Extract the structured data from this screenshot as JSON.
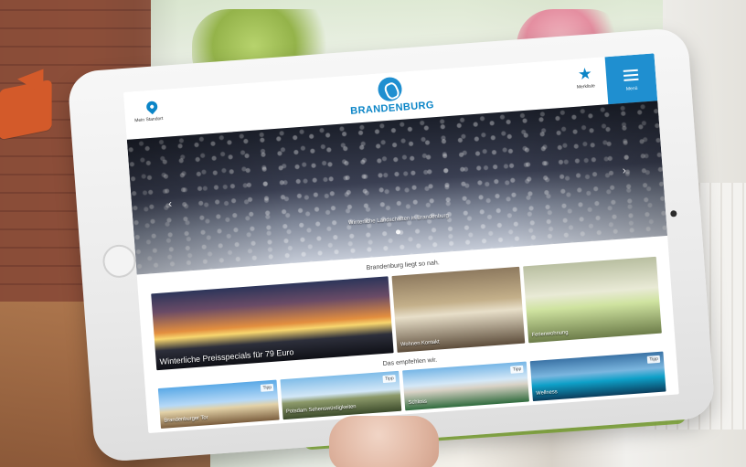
{
  "site": {
    "logo_text": "BRANDENBURG",
    "location_label": "Mein Standort",
    "merkliste_label": "Merkliste",
    "menu_label": "Menü"
  },
  "hero": {
    "caption": "Winterliche Landschaften in Brandenburg",
    "arrow_left": "‹",
    "arrow_right": "›"
  },
  "sections": [
    {
      "title": "Brandenburg liegt so nah.",
      "cards": [
        {
          "caption": "Winterliche Preisspecials für 79 Euro"
        },
        {
          "caption": "Wohnen Kontakt"
        },
        {
          "caption": "Ferienwohnung"
        }
      ]
    },
    {
      "title": "Das empfehlen wir.",
      "cards": [
        {
          "caption": "Brandenburger Tor",
          "tag": "Tipp"
        },
        {
          "caption": "Potsdam Sehenswürdigkeiten",
          "tag": "Tipp"
        },
        {
          "caption": "Schloss",
          "tag": "Tipp"
        },
        {
          "caption": "Wellness",
          "tag": "Tipp"
        }
      ]
    }
  ],
  "colors": {
    "accent": "#1f8fd0",
    "accent_text": "#0b85c7"
  },
  "icons": {
    "location": "location-pin-icon",
    "logo": "brandenburg-logo-icon",
    "merkliste": "star-icon",
    "menu": "hamburger-menu-icon",
    "decor_arrow": "arrow-icon"
  }
}
